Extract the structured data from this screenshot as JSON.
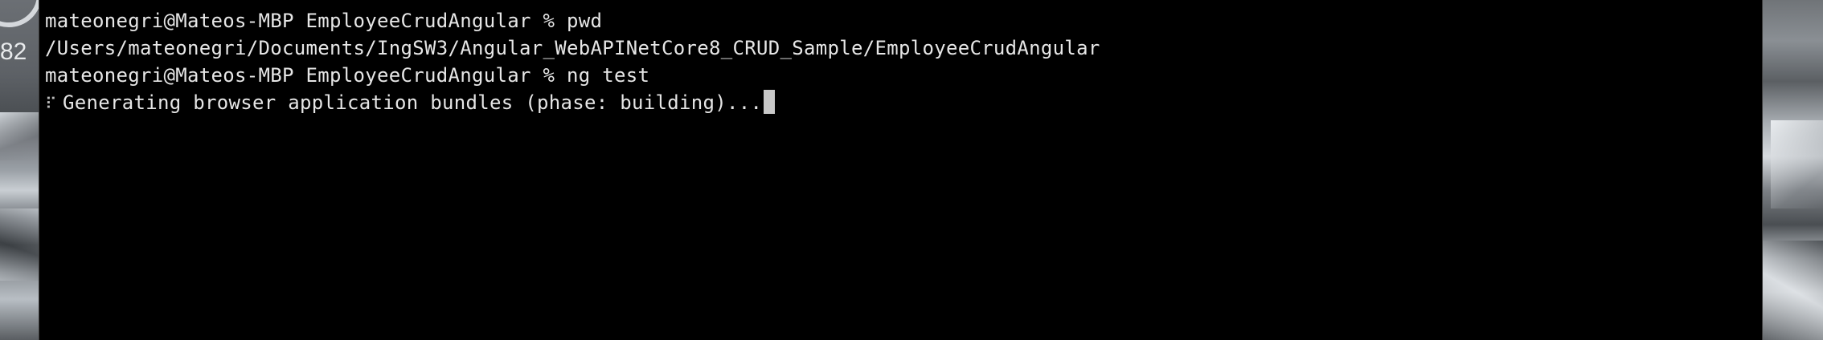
{
  "desktop": {
    "left_widget_number": "82"
  },
  "terminal": {
    "lines": [
      {
        "text": "..."
      },
      {
        "text": "mateonegri@Mateos-MBP EmployeeCrudAngular % pwd"
      },
      {
        "text": "/Users/mateonegri/Documents/IngSW3/Angular_WebAPINetCore8_CRUD_Sample/EmployeeCrudAngular"
      },
      {
        "text": "mateonegri@Mateos-MBP EmployeeCrudAngular % ng test"
      }
    ],
    "progress": {
      "spinner": "⠏",
      "text": "Generating browser application bundles (phase: building)..."
    }
  },
  "colors": {
    "terminal_background": "#000000",
    "terminal_text": "#e6e6e6",
    "cursor": "#c9c9c9"
  },
  "icons": [
    "spinner-icon",
    "cursor-block"
  ]
}
